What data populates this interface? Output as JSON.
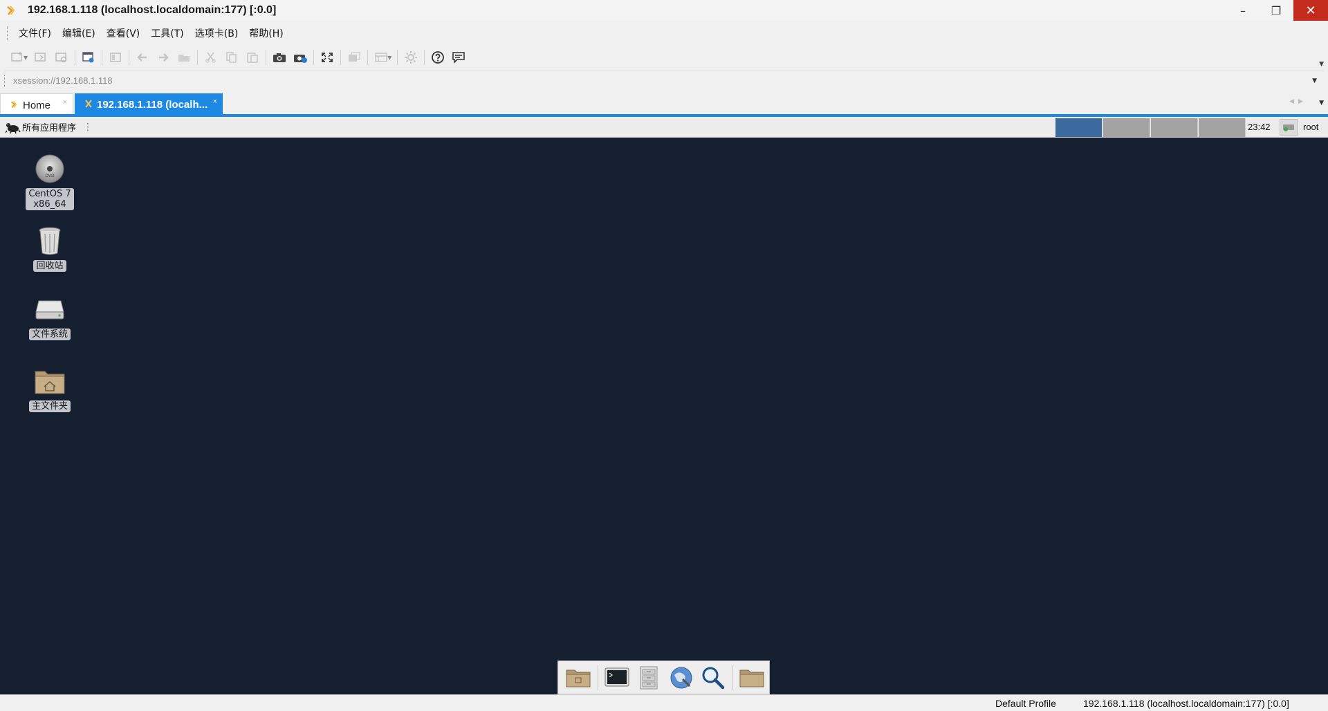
{
  "window": {
    "title": "192.168.1.118 (localhost.localdomain:177) [:0.0]",
    "minimize_glyph": "–",
    "restore_glyph": "❐",
    "close_glyph": "✕"
  },
  "menu": {
    "items": [
      "文件(F)",
      "编辑(E)",
      "查看(V)",
      "工具(T)",
      "选项卡(B)",
      "帮助(H)"
    ]
  },
  "toolbar": {
    "icons": [
      "new-session-icon",
      "open-session-icon",
      "reconnect-icon",
      "session-properties-icon",
      "layout-icon",
      "back-icon",
      "forward-icon",
      "folder-icon",
      "cut-icon",
      "copy-icon",
      "paste-icon",
      "screenshot-icon",
      "screenshot-settings-icon",
      "fullscreen-icon",
      "detach-icon",
      "view-options-icon",
      "settings-icon",
      "help-icon",
      "chat-icon"
    ]
  },
  "address": {
    "value": "xsession://192.168.1.118"
  },
  "tabs": {
    "home_label": "Home",
    "active_label": "192.168.1.118 (localh...",
    "close_glyph": "×"
  },
  "remote_panel": {
    "apps_label": "所有应用程序",
    "workspaces": 4,
    "active_workspace": 1,
    "clock": "23:42",
    "user": "root"
  },
  "desktop_icons": [
    {
      "label_line1": "CentOS 7",
      "label_line2": "x86_64",
      "icon": "dvd-icon"
    },
    {
      "label": "回收站",
      "icon": "trash-icon"
    },
    {
      "label": "文件系统",
      "icon": "drive-icon"
    },
    {
      "label": "主文件夹",
      "icon": "home-folder-icon"
    }
  ],
  "dock": {
    "items": [
      "show-desktop-icon",
      "terminal-icon",
      "file-cabinet-icon",
      "web-browser-icon",
      "search-icon",
      "folder-icon"
    ]
  },
  "statusbar": {
    "profile": "Default Profile",
    "session": "192.168.1.118 (localhost.localdomain:177) [:0.0]"
  },
  "colors": {
    "accent": "#1e88e5",
    "desktop_bg": "#151f30",
    "close_button": "#c42b1c",
    "active_workspace": "#3d6a9e"
  }
}
